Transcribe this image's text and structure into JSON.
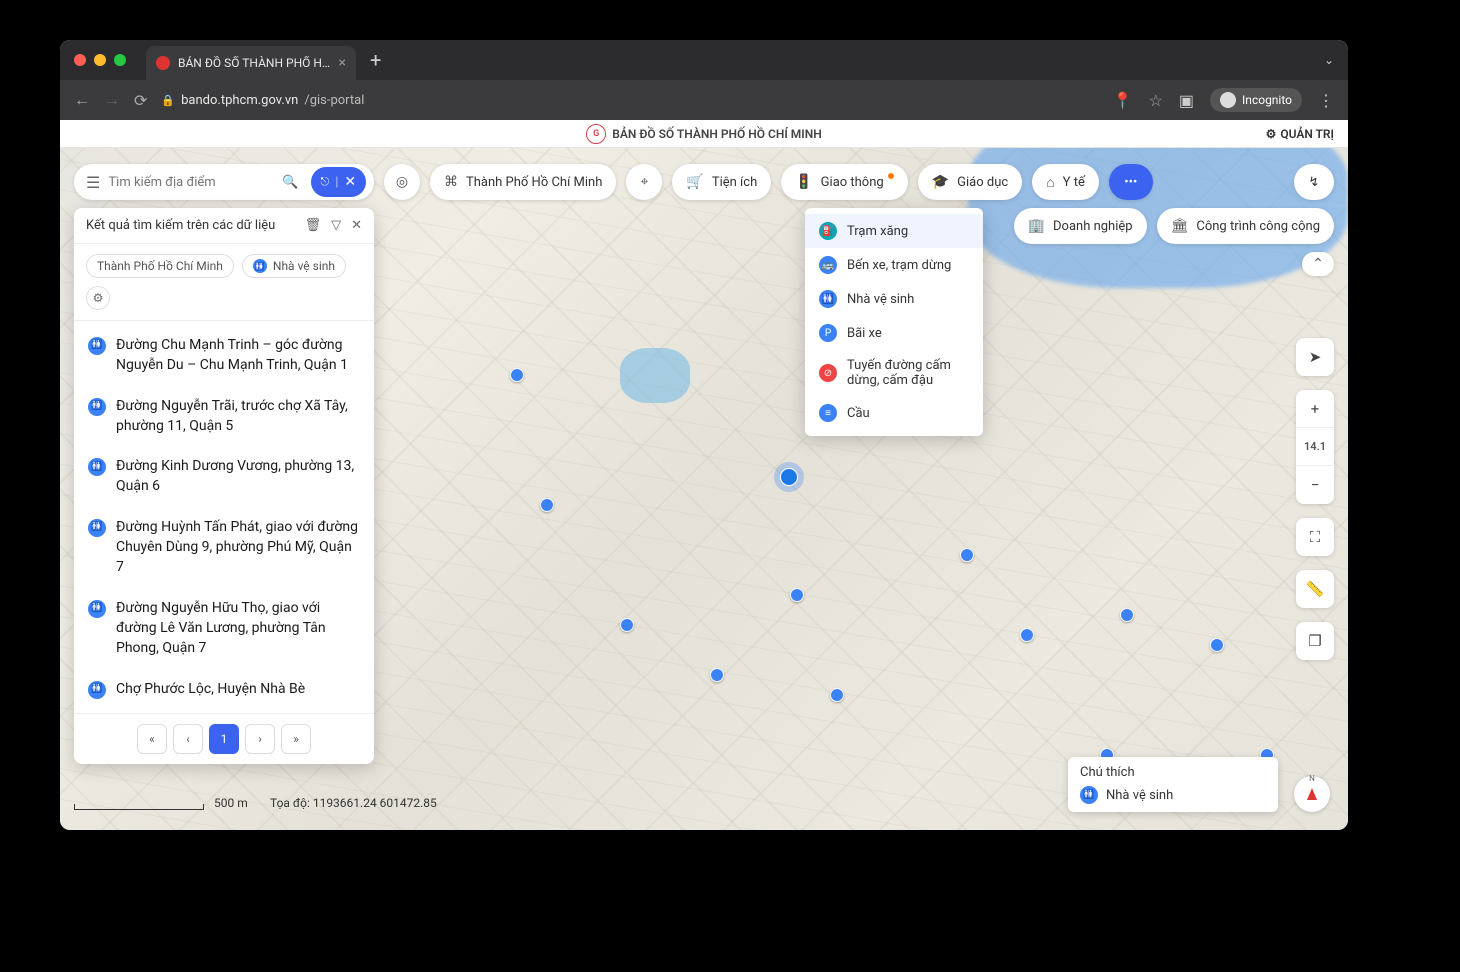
{
  "browser": {
    "tab_title": "BẢN ĐỒ SỐ THÀNH PHỐ HỒ C",
    "url_host": "bando.tphcm.gov.vn",
    "url_path": "/gis-portal",
    "incognito": "Incognito"
  },
  "header": {
    "title": "BẢN ĐỒ SỐ THÀNH PHỐ HỒ CHÍ MINH",
    "admin": "QUẢN TRỊ"
  },
  "search": {
    "placeholder": "Tìm kiếm địa điểm"
  },
  "topbar": {
    "region": "Thành Phố Hồ Chí Minh",
    "tien_ich": "Tiện ích",
    "giao_thong": "Giao thông",
    "giao_duc": "Giáo dục",
    "y_te": "Y tế",
    "doanh_nghiep": "Doanh nghiệp",
    "cong_trinh": "Công trình công cộng"
  },
  "dropdown": {
    "items": [
      {
        "label": "Trạm xăng",
        "color": "#0ea5b5"
      },
      {
        "label": "Bến xe, trạm dừng",
        "color": "#3b82f6"
      },
      {
        "label": "Nhà vệ sinh",
        "color": "#3b82f6"
      },
      {
        "label": "Bãi xe",
        "color": "#3b82f6"
      },
      {
        "label": "Tuyến đường cấm dừng, cấm đậu",
        "color": "#ef4444"
      },
      {
        "label": "Cầu",
        "color": "#3b82f6"
      }
    ]
  },
  "results": {
    "title": "Kết quả tìm kiếm trên các dữ liệu",
    "chip_region": "Thành Phố Hồ Chí Minh",
    "chip_layer": "Nhà vệ sinh",
    "items": [
      "Đường Chu Mạnh Trinh – góc đường Nguyễn Du – Chu Mạnh Trinh, Quận 1",
      "Đường Nguyễn Trãi, trước chợ Xã Tây, phường 11, Quận 5",
      "Đường Kinh Dương Vương, phường 13, Quận 6",
      "Đường Huỳnh Tấn Phát, giao với đường Chuyên Dùng 9, phường Phú Mỹ, Quận 7",
      "Đường Nguyễn Hữu Thọ, giao với đường Lê Văn Lương, phường Tân Phong, Quận 7",
      "Chợ Phước Lộc, Huyện Nhà Bè"
    ],
    "page": "1"
  },
  "zoom_level": "14.1",
  "scale_label": "500 m",
  "coords": "Tọa độ: 1193661.24     601472.85",
  "legend": {
    "title": "Chú thích",
    "item": "Nhà vệ sinh"
  }
}
